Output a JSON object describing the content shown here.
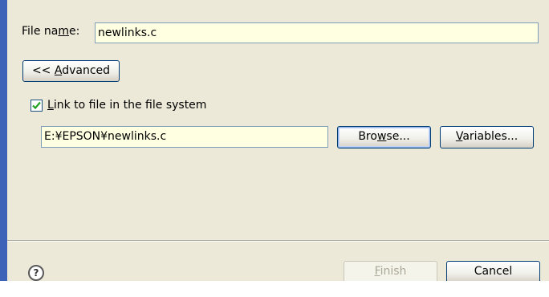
{
  "file_name": {
    "label_pre": "File na",
    "label_mnemonic": "m",
    "label_post": "e:",
    "value": "newlinks.c"
  },
  "advanced_button": {
    "prefix": "<< ",
    "mnemonic": "A",
    "rest": "dvanced"
  },
  "link_checkbox": {
    "checked": true,
    "mnemonic": "L",
    "rest": "ink to file in the file system"
  },
  "link_path": {
    "value": "E:¥EPSON¥newlinks.c"
  },
  "browse_button": {
    "pre": "Bro",
    "mnemonic": "w",
    "post": "se..."
  },
  "variables_button": {
    "mnemonic": "V",
    "rest": "ariables..."
  },
  "finish_button": {
    "mnemonic": "F",
    "rest": "inish",
    "enabled": false
  },
  "cancel_button": {
    "label": "Cancel"
  },
  "help_icon": {
    "name": "help-icon",
    "glyph": "?"
  },
  "colors": {
    "accent_bar": "#3d63b8",
    "field_bg": "#ffffe1",
    "dialog_bg": "#ece9d8"
  }
}
